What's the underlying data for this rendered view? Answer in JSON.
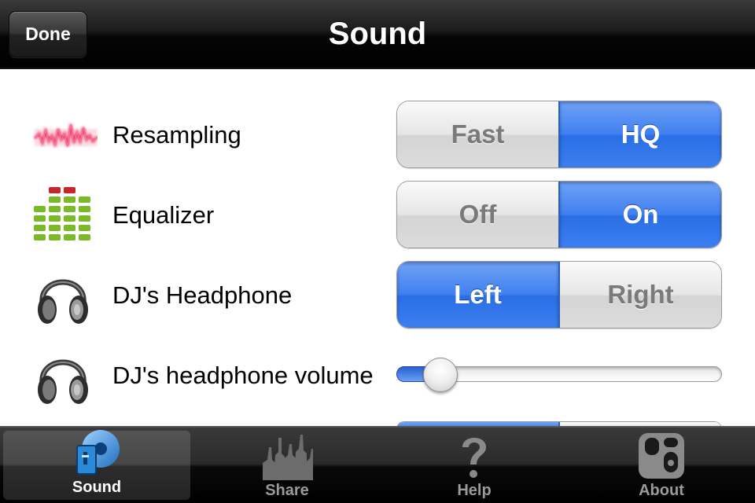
{
  "navbar": {
    "done_label": "Done",
    "title": "Sound"
  },
  "rows": [
    {
      "label": "Resampling",
      "icon": "waveform-icon",
      "options": [
        "Fast",
        "HQ"
      ],
      "selected": "HQ"
    },
    {
      "label": "Equalizer",
      "icon": "equalizer-icon",
      "options": [
        "Off",
        "On"
      ],
      "selected": "On"
    },
    {
      "label": "DJ's Headphone",
      "icon": "headphones-icon",
      "options": [
        "Left",
        "Right"
      ],
      "selected": "Left"
    },
    {
      "label": "DJ's headphone volume",
      "icon": "headphones-icon",
      "control": "slider",
      "value": 0.12
    }
  ],
  "tabbar": {
    "selected": "Sound",
    "tabs": [
      {
        "label": "Sound",
        "icon": "sound-settings-icon"
      },
      {
        "label": "Share",
        "icon": "crowd-icon"
      },
      {
        "label": "Help",
        "icon": "question-mark-icon"
      },
      {
        "label": "About",
        "icon": "about-logo-icon"
      }
    ]
  },
  "colors": {
    "accent_blue": "#3f7ff0",
    "segment_off_text": "#7a7a7a",
    "tab_inactive_text": "#9a9a9a"
  }
}
